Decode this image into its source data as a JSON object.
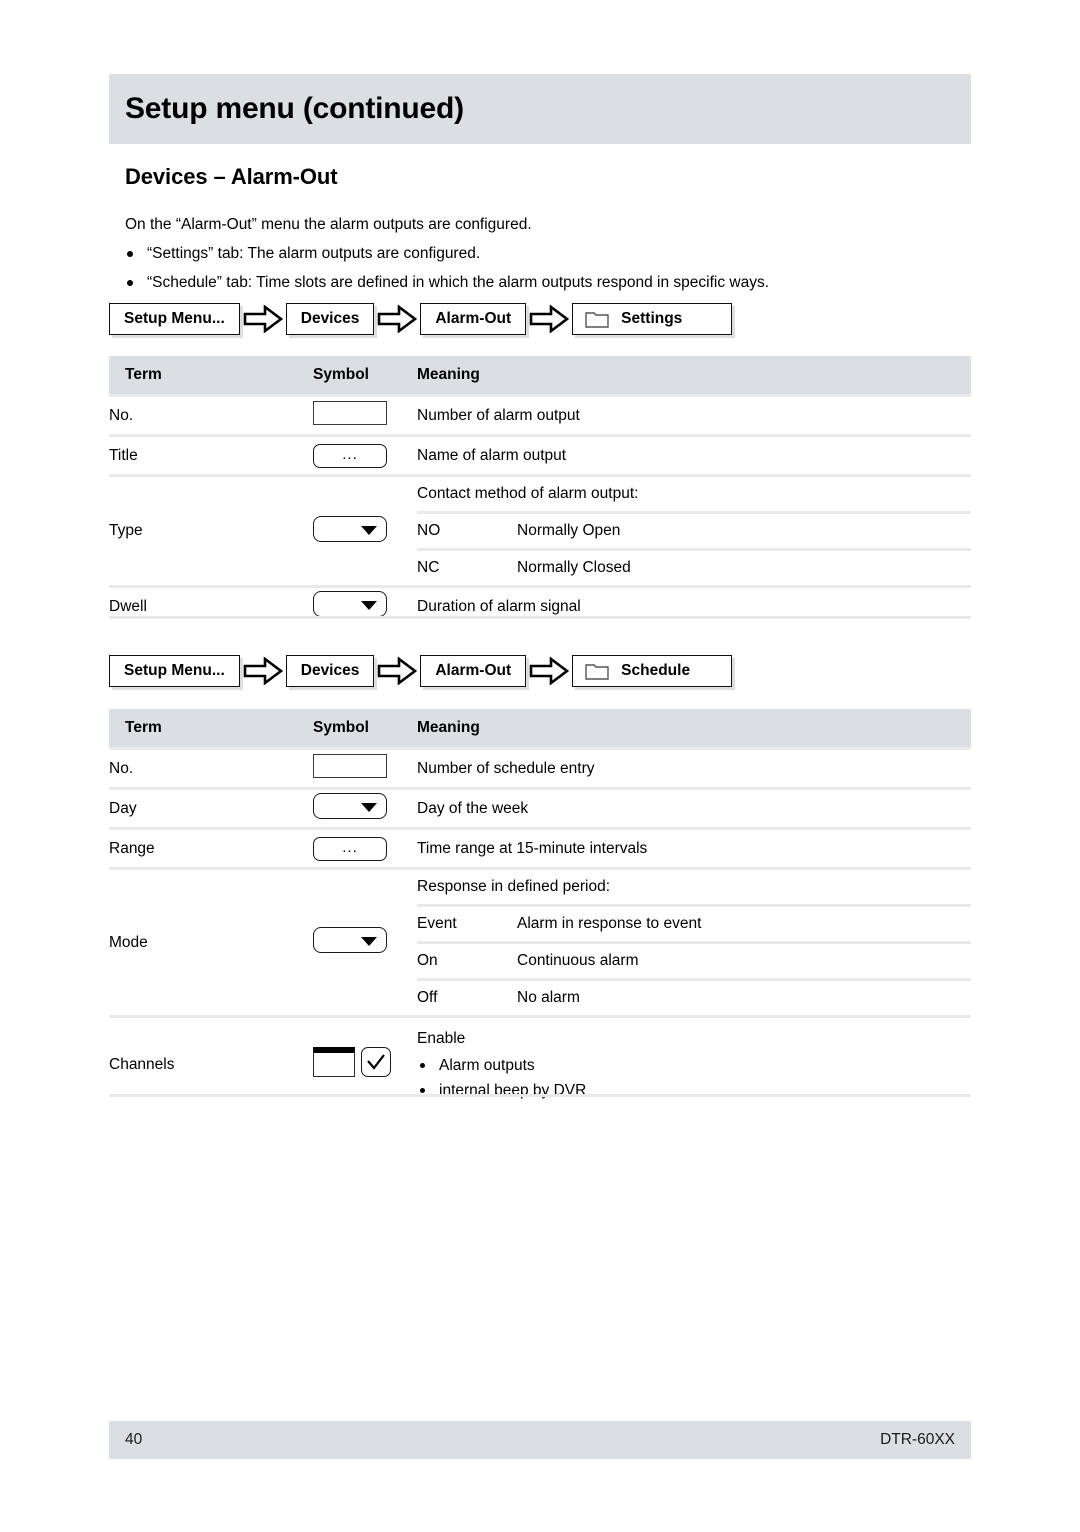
{
  "header": {
    "chapter_title": "Setup menu (continued)"
  },
  "section": {
    "heading": "Devices – Alarm-Out",
    "lead": "On the “Alarm-Out” menu the alarm outputs are configured.",
    "bullets": [
      "“Settings” tab: The alarm outputs are configured.",
      "“Schedule” tab: Time slots are defined in which the alarm outputs respond in specific ways."
    ]
  },
  "breadcrumb_settings": {
    "crumbs": [
      "Setup Menu...",
      "Devices",
      "Alarm-Out",
      "Settings"
    ],
    "arrow_icon": "right-block-arrow-icon",
    "folder_icon": "folder-tab-icon"
  },
  "breadcrumb_schedule": {
    "crumbs": [
      "Setup Menu...",
      "Devices",
      "Alarm-Out",
      "Schedule"
    ],
    "arrow_icon": "right-block-arrow-icon",
    "folder_icon": "folder-tab-icon"
  },
  "table_settings": {
    "columns": [
      "Term",
      "Symbol",
      "Meaning"
    ],
    "rows": [
      {
        "term": "No.",
        "symbol": "text-box",
        "meaning": "Number of alarm output"
      },
      {
        "term": "Title",
        "symbol": "ellipsis-button",
        "symbol_label": "...",
        "meaning": "Name of alarm output"
      },
      {
        "term": "Type",
        "symbol": "dropdown-box",
        "meaning_intro": "Contact method of alarm output:",
        "options": [
          {
            "key": "NO",
            "desc": "Normally Open"
          },
          {
            "key": "NC",
            "desc": "Normally Closed"
          }
        ]
      },
      {
        "term": "Dwell",
        "symbol": "dropdown-box",
        "meaning": "Duration of alarm signal"
      }
    ]
  },
  "table_schedule": {
    "columns": [
      "Term",
      "Symbol",
      "Meaning"
    ],
    "rows": [
      {
        "term": "No.",
        "symbol": "text-box",
        "meaning": "Number of schedule entry"
      },
      {
        "term": "Day",
        "symbol": "dropdown-box",
        "meaning": "Day of the week"
      },
      {
        "term": "Range",
        "symbol": "ellipsis-button",
        "symbol_label": "...",
        "meaning": "Time range at 15-minute intervals"
      },
      {
        "term": "Mode",
        "symbol": "dropdown-box",
        "meaning_intro": "Response in defined period:",
        "options": [
          {
            "key": "Event",
            "desc": "Alarm in response to event"
          },
          {
            "key": "On",
            "desc": "Continuous alarm"
          },
          {
            "key": "Off",
            "desc": "No alarm"
          }
        ]
      },
      {
        "term": "Channels",
        "symbol": "listbox-and-checkbox",
        "meaning_intro": "Enable",
        "bullets": [
          "Alarm outputs",
          "internal beep by DVR"
        ]
      }
    ]
  },
  "footer": {
    "page_number": "40",
    "document_id": "DTR-60XX"
  },
  "colors": {
    "band_gray": "#dcdfe1",
    "rule_gray": "#e7e9ea",
    "text": "#000000"
  }
}
